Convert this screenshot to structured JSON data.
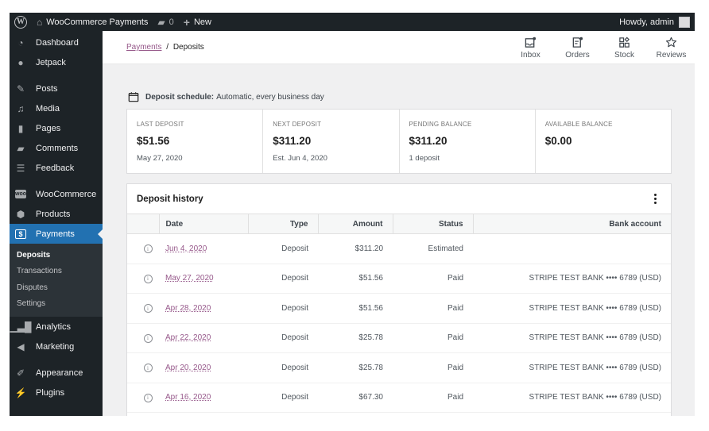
{
  "admin_bar": {
    "site_name": "WooCommerce Payments",
    "comments_count": "0",
    "new_label": "New",
    "greeting": "Howdy, admin"
  },
  "sidebar": {
    "items": [
      {
        "label": "Dashboard",
        "icon": "dashboard-icon"
      },
      {
        "label": "Jetpack",
        "icon": "jetpack-icon"
      },
      {
        "label": "Posts",
        "icon": "pin-icon"
      },
      {
        "label": "Media",
        "icon": "media-icon"
      },
      {
        "label": "Pages",
        "icon": "pages-icon"
      },
      {
        "label": "Comments",
        "icon": "comment-icon"
      },
      {
        "label": "Feedback",
        "icon": "feedback-icon"
      },
      {
        "label": "WooCommerce",
        "icon": "woo-icon"
      },
      {
        "label": "Products",
        "icon": "box-icon"
      },
      {
        "label": "Payments",
        "icon": "dollar-icon"
      },
      {
        "label": "Analytics",
        "icon": "bar-chart-icon"
      },
      {
        "label": "Marketing",
        "icon": "megaphone-icon"
      },
      {
        "label": "Appearance",
        "icon": "brush-icon"
      },
      {
        "label": "Plugins",
        "icon": "plug-icon"
      }
    ],
    "payments_submenu": [
      "Deposits",
      "Transactions",
      "Disputes",
      "Settings"
    ],
    "active_item": "Payments",
    "current_sub": "Deposits"
  },
  "header": {
    "breadcrumb_parent": "Payments",
    "breadcrumb_separator": "/",
    "breadcrumb_current": "Deposits",
    "activity": [
      {
        "label": "Inbox",
        "icon": "inbox-icon"
      },
      {
        "label": "Orders",
        "icon": "orders-icon"
      },
      {
        "label": "Stock",
        "icon": "stock-icon"
      },
      {
        "label": "Reviews",
        "icon": "star-icon"
      }
    ]
  },
  "schedule": {
    "label": "Deposit schedule:",
    "value": "Automatic, every business day"
  },
  "summary": [
    {
      "label": "LAST DEPOSIT",
      "value": "$51.56",
      "sub": "May 27, 2020"
    },
    {
      "label": "NEXT DEPOSIT",
      "value": "$311.20",
      "sub": "Est. Jun 4, 2020"
    },
    {
      "label": "PENDING BALANCE",
      "value": "$311.20",
      "sub": "1 deposit"
    },
    {
      "label": "AVAILABLE BALANCE",
      "value": "$0.00",
      "sub": ""
    }
  ],
  "history": {
    "title": "Deposit history",
    "columns": [
      "Date",
      "Type",
      "Amount",
      "Status",
      "Bank account"
    ],
    "rows": [
      {
        "date": "Jun 4, 2020",
        "type": "Deposit",
        "amount": "$311.20",
        "status": "Estimated",
        "bank": ""
      },
      {
        "date": "May 27, 2020",
        "type": "Deposit",
        "amount": "$51.56",
        "status": "Paid",
        "bank": "STRIPE TEST BANK •••• 6789 (USD)"
      },
      {
        "date": "Apr 28, 2020",
        "type": "Deposit",
        "amount": "$51.56",
        "status": "Paid",
        "bank": "STRIPE TEST BANK •••• 6789 (USD)"
      },
      {
        "date": "Apr 22, 2020",
        "type": "Deposit",
        "amount": "$25.78",
        "status": "Paid",
        "bank": "STRIPE TEST BANK •••• 6789 (USD)"
      },
      {
        "date": "Apr 20, 2020",
        "type": "Deposit",
        "amount": "$25.78",
        "status": "Paid",
        "bank": "STRIPE TEST BANK •••• 6789 (USD)"
      },
      {
        "date": "Apr 16, 2020",
        "type": "Deposit",
        "amount": "$67.30",
        "status": "Paid",
        "bank": "STRIPE TEST BANK •••• 6789 (USD)"
      }
    ]
  },
  "colors": {
    "admin_dark": "#1d2327",
    "active_blue": "#2271b1",
    "link_purple": "#96588a",
    "page_bg": "#f0f0f1"
  }
}
